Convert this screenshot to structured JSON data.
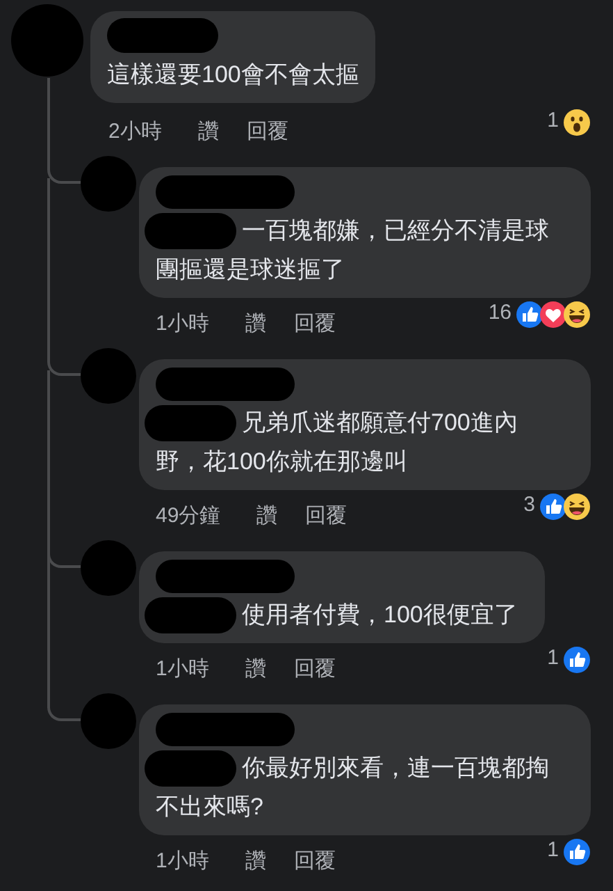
{
  "comment": {
    "text": "這樣還要100會不會太摳",
    "time": "2小時",
    "like_label": "讚",
    "reply_label": "回覆",
    "reaction_count": "1",
    "reactions": [
      {
        "kind": "wow"
      }
    ],
    "replies": [
      {
        "has_mention": true,
        "text": "一百塊都嫌，已經分不清是球團摳還是球迷摳了",
        "time": "1小時",
        "like_label": "讚",
        "reply_label": "回覆",
        "reaction_count": "16",
        "reactions": [
          {
            "kind": "like"
          },
          {
            "kind": "love"
          },
          {
            "kind": "haha"
          }
        ]
      },
      {
        "has_mention": true,
        "text": "兄弟爪迷都願意付700進內野，花100你就在那邊叫",
        "time": "49分鐘",
        "like_label": "讚",
        "reply_label": "回覆",
        "reaction_count": "3",
        "reactions": [
          {
            "kind": "like"
          },
          {
            "kind": "haha"
          }
        ]
      },
      {
        "has_mention": true,
        "text": "使用者付費，100很便宜了",
        "time": "1小時",
        "like_label": "讚",
        "reply_label": "回覆",
        "reaction_count": "1",
        "reactions": [
          {
            "kind": "like"
          }
        ]
      },
      {
        "has_mention": true,
        "text": "你最好別來看，連一百塊都掏不出來嗎?",
        "time": "1小時",
        "like_label": "讚",
        "reply_label": "回覆",
        "reaction_count": "1",
        "reactions": [
          {
            "kind": "like"
          }
        ]
      }
    ]
  }
}
